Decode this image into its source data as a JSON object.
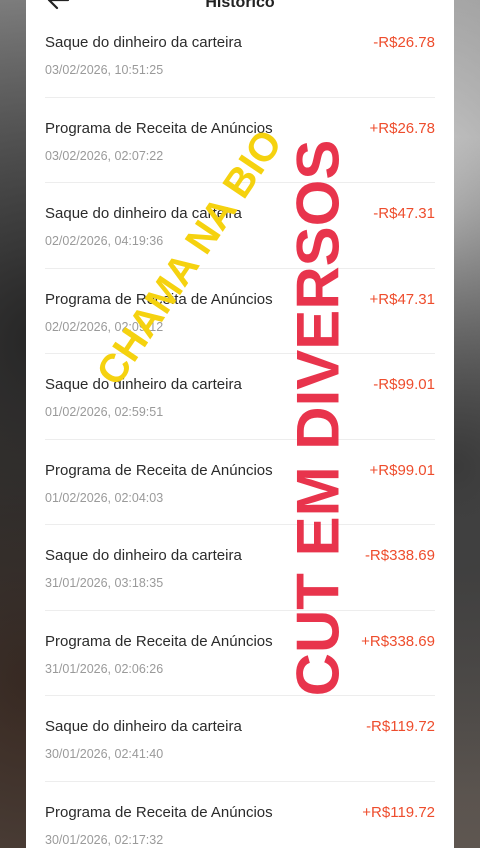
{
  "header": {
    "title": "Histórico",
    "back_icon": "arrow-left-icon"
  },
  "transactions": [
    {
      "title": "Saque do dinheiro da carteira",
      "date": "03/02/2026, 10:51:25",
      "amount": "-R$26.78"
    },
    {
      "title": "Programa de Receita de Anúncios",
      "date": "03/02/2026, 02:07:22",
      "amount": "+R$26.78"
    },
    {
      "title": "Saque do dinheiro da carteira",
      "date": "02/02/2026, 04:19:36",
      "amount": "-R$47.31"
    },
    {
      "title": "Programa de Receita de Anúncios",
      "date": "02/02/2026, 02:09:12",
      "amount": "+R$47.31"
    },
    {
      "title": "Saque do dinheiro da carteira",
      "date": "01/02/2026, 02:59:51",
      "amount": "-R$99.01"
    },
    {
      "title": "Programa de Receita de Anúncios",
      "date": "01/02/2026, 02:04:03",
      "amount": "+R$99.01"
    },
    {
      "title": "Saque do dinheiro da carteira",
      "date": "31/01/2026, 03:18:35",
      "amount": "-R$338.69"
    },
    {
      "title": "Programa de Receita de Anúncios",
      "date": "31/01/2026, 02:06:26",
      "amount": "+R$338.69"
    },
    {
      "title": "Saque do dinheiro da carteira",
      "date": "30/01/2026, 02:41:40",
      "amount": "-R$119.72"
    },
    {
      "title": "Programa de Receita de Anúncios",
      "date": "30/01/2026, 02:17:32",
      "amount": "+R$119.72"
    }
  ],
  "overlay": {
    "yellow_text": "CHAMA NA BIO",
    "red_text": "CUT EM DIVERSOS"
  },
  "colors": {
    "amount": "#ee4d2d",
    "overlay_yellow": "#f5d20f",
    "overlay_red": "#e8344c"
  }
}
